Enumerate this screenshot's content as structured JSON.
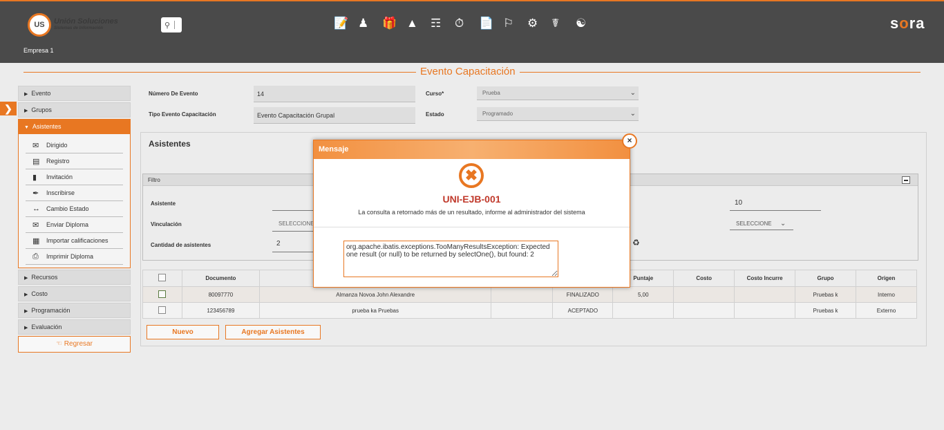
{
  "header": {
    "logo_mark": "US",
    "logo_title": "Unión Soluciones",
    "logo_subtitle": "Sistemas de Información",
    "brand": "sora",
    "empresa": "Empresa 1",
    "icons": [
      "report-edit-icon",
      "person-icon",
      "gift-icon",
      "org-chart-icon",
      "person-card-icon",
      "stopwatch-icon",
      "document-icon",
      "signpost-icon",
      "gears-icon",
      "medical-briefcase-icon",
      "support-group-icon"
    ]
  },
  "page": {
    "title": "Evento Capacitación"
  },
  "sidebar": {
    "items": [
      {
        "label": "Evento"
      },
      {
        "label": "Grupos"
      },
      {
        "label": "Asistentes"
      }
    ],
    "subitems": [
      {
        "label": "Dirigido",
        "icon": "mail-send-icon"
      },
      {
        "label": "Registro",
        "icon": "list-icon"
      },
      {
        "label": "Invitación",
        "icon": "document-icon"
      },
      {
        "label": "Inscribirse",
        "icon": "pen-icon"
      },
      {
        "label": "Cambio Estado",
        "icon": "arrows-icon"
      },
      {
        "label": "Enviar Diploma",
        "icon": "envelope-icon"
      },
      {
        "label": "Importar calificaciones",
        "icon": "import-icon"
      },
      {
        "label": "Imprimir Diploma",
        "icon": "printer-icon"
      }
    ],
    "bottom_items": [
      {
        "label": "Recursos"
      },
      {
        "label": "Costo"
      },
      {
        "label": "Programación"
      },
      {
        "label": "Evaluación"
      }
    ],
    "back_label": "Regresar"
  },
  "form": {
    "numero_label": "Número De Evento",
    "numero_value": "14",
    "tipo_label": "Tipo Evento Capacitación",
    "tipo_value": "Evento Capacitación Grupal",
    "curso_label": "Curso*",
    "curso_value": "Prueba",
    "estado_label": "Estado",
    "estado_value": "Programado"
  },
  "asistentes": {
    "title": "Asistentes",
    "filtro_title": "Filtro",
    "asistente_label": "Asistente",
    "vinculacion_label": "Vinculación",
    "vinculacion_value": "SELECCIONE",
    "cantidad_label": "Cantidad de asistentes",
    "cantidad_value": "2",
    "right_value": "10",
    "right_select": "SELECCIONE"
  },
  "table": {
    "columns": [
      "",
      "Documento",
      "",
      "",
      "",
      "Puntaje",
      "Costo",
      "Costo Incurre",
      "Grupo",
      "Origen"
    ],
    "rows": [
      {
        "documento": "80097770",
        "nombre": "Almanza Novoa John Alexandre",
        "c3": "",
        "estado": "FINALIZADO",
        "puntaje": "5,00",
        "costo": "",
        "costo_incurre": "",
        "grupo": "Pruebas k",
        "origen": "Interno"
      },
      {
        "documento": "123456789",
        "nombre": "prueba ka Pruebas",
        "c3": "",
        "estado": "ACEPTADO",
        "puntaje": "",
        "costo": "",
        "costo_incurre": "",
        "grupo": "Pruebas k",
        "origen": "Externo"
      }
    ]
  },
  "buttons": {
    "nuevo": "Nuevo",
    "agregar": "Agregar Asistentes"
  },
  "modal": {
    "title": "Mensaje",
    "close": "×",
    "error_icon": "✖",
    "code": "UNI-EJB-001",
    "message": "La consulta a retornado más de un resultado, informe al administrador del sistema",
    "detail": "org.apache.ibatis.exceptions.TooManyResultsException: Expected one result (or null) to be returned by selectOne(), but found: 2"
  },
  "colors": {
    "accent": "#e87722",
    "topbar": "#4a4a4a",
    "error": "#c0392b"
  }
}
